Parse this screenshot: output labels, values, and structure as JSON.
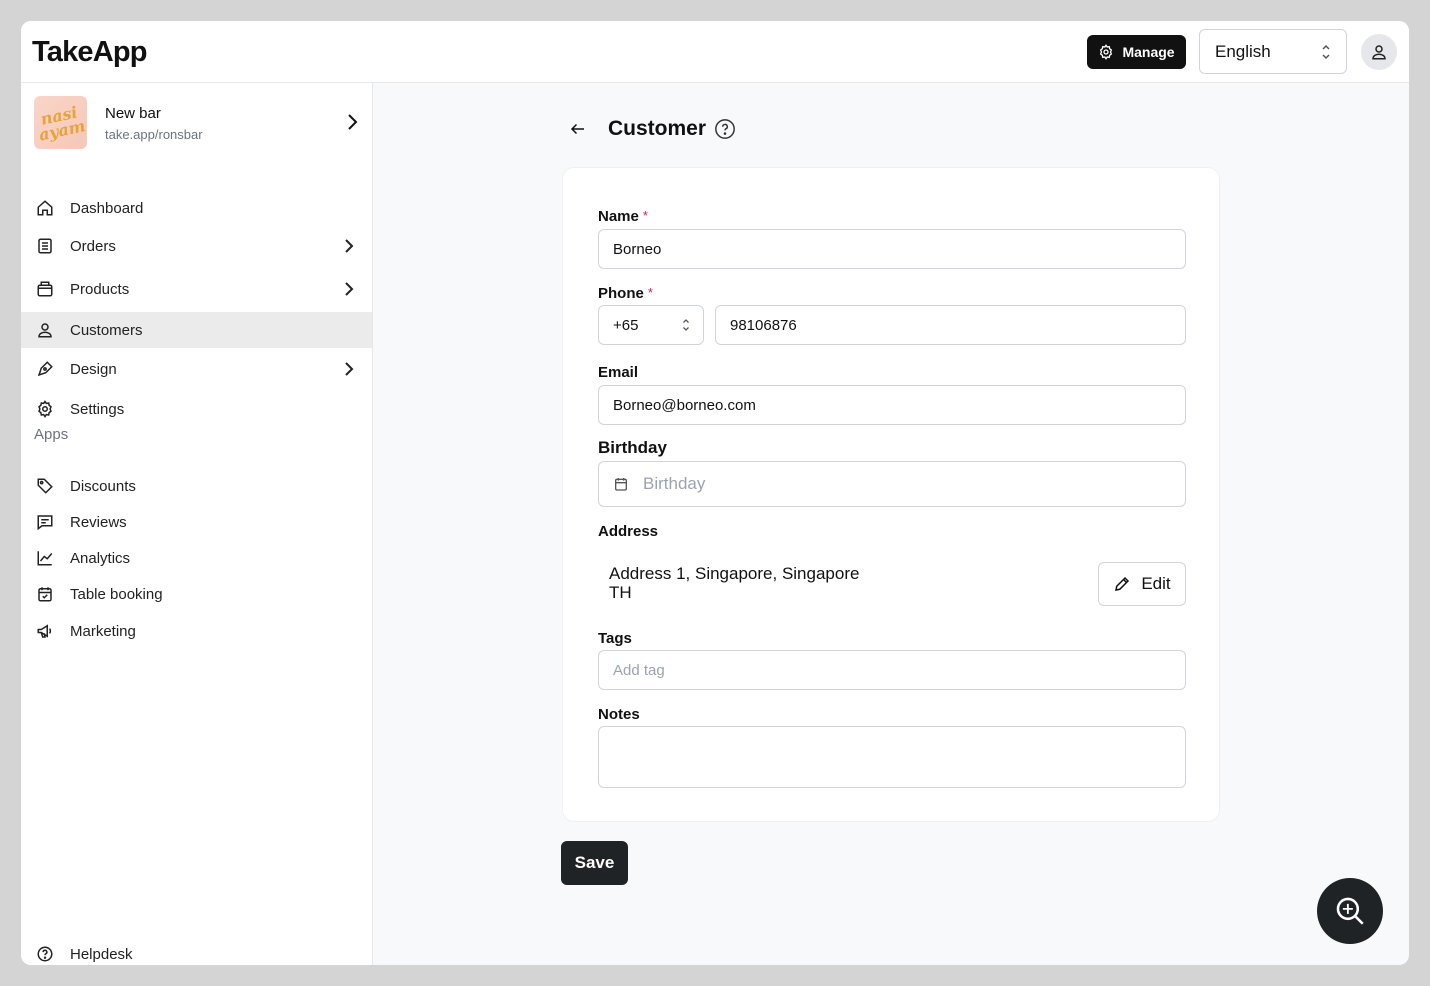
{
  "header": {
    "logo": "TakeApp",
    "manage_label": "Manage",
    "language": "English"
  },
  "sidebar": {
    "store": {
      "name": "New bar",
      "url": "take.app/ronsbar",
      "image_text": "nasi ayam"
    },
    "items": [
      {
        "label": "Dashboard",
        "icon": "home-icon"
      },
      {
        "label": "Orders",
        "icon": "orders-icon",
        "has_children": true
      },
      {
        "label": "Products",
        "icon": "products-icon",
        "has_children": true
      },
      {
        "label": "Customers",
        "icon": "user-icon",
        "active": true
      },
      {
        "label": "Design",
        "icon": "pen-icon",
        "has_children": true
      },
      {
        "label": "Settings",
        "icon": "gear-icon"
      }
    ],
    "apps_label": "Apps",
    "apps": [
      {
        "label": "Discounts",
        "icon": "tag-icon"
      },
      {
        "label": "Reviews",
        "icon": "chat-icon"
      },
      {
        "label": "Analytics",
        "icon": "chart-icon"
      },
      {
        "label": "Table booking",
        "icon": "calendar-check-icon"
      },
      {
        "label": "Marketing",
        "icon": "megaphone-icon"
      }
    ],
    "helpdesk_label": "Helpdesk"
  },
  "main": {
    "title": "Customer",
    "form": {
      "name_label": "Name",
      "name_value": "Borneo",
      "phone_label": "Phone",
      "phone_code": "+65",
      "phone_value": "98106876",
      "email_label": "Email",
      "email_value": "Borneo@borneo.com",
      "birthday_label": "Birthday",
      "birthday_placeholder": "Birthday",
      "address_label": "Address",
      "address_line1": "Address 1, Singapore, Singapore",
      "address_line2": "TH",
      "edit_label": "Edit",
      "tags_label": "Tags",
      "tags_placeholder": "Add tag",
      "notes_label": "Notes",
      "notes_value": "",
      "required_mark": "*"
    },
    "save_label": "Save"
  }
}
